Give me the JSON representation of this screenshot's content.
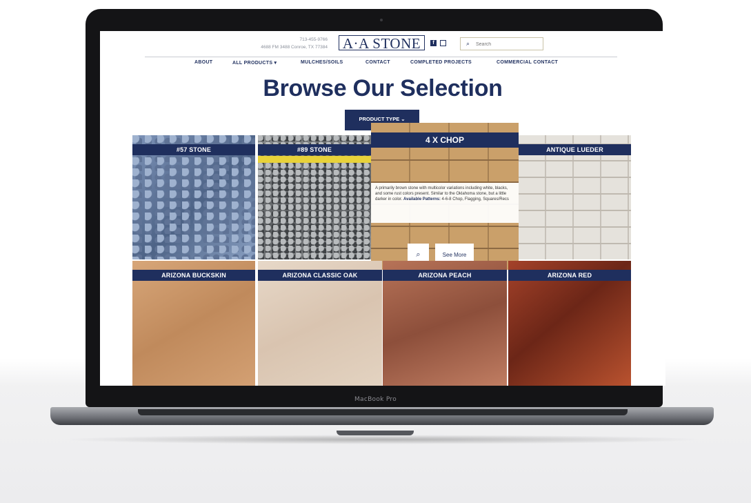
{
  "device": {
    "label": "MacBook Pro"
  },
  "site": {
    "contact": {
      "phone": "713-455-9766",
      "address": "4688 FM 3488 Conroe, TX 77384"
    },
    "logo": "A·A STONE",
    "social": [
      "f",
      "ig"
    ],
    "search": {
      "placeholder": "Search"
    },
    "nav": [
      "ABOUT",
      "ALL PRODUCTS ▾",
      "MULCHES/SOILS",
      "CONTACT",
      "COMPLETED PROJECTS",
      "COMMERCIAL CONTACT"
    ],
    "heading": "Browse Our Selection",
    "filter_button": "PRODUCT TYPE ⌄",
    "products": [
      {
        "name": "#57 STONE"
      },
      {
        "name": "#89 STONE"
      },
      {
        "name": "ANTIQUE LUEDER"
      },
      {
        "name": "ARIZONA BUCKSKIN"
      },
      {
        "name": "ARIZONA CLASSIC OAK"
      },
      {
        "name": "ARIZONA PEACH"
      },
      {
        "name": "ARIZONA RED"
      }
    ],
    "featured": {
      "name": "4 X CHOP",
      "description": "A primarily brown stone with multicolor variations including white, blacks, and some rust colors present. Similar to the Oklahoma stone, but a little darker in color.",
      "patterns_label": "Available Patterns:",
      "patterns": "4-6-8 Chop, Flagging, Squares/Recs",
      "see_more": "See More"
    }
  }
}
